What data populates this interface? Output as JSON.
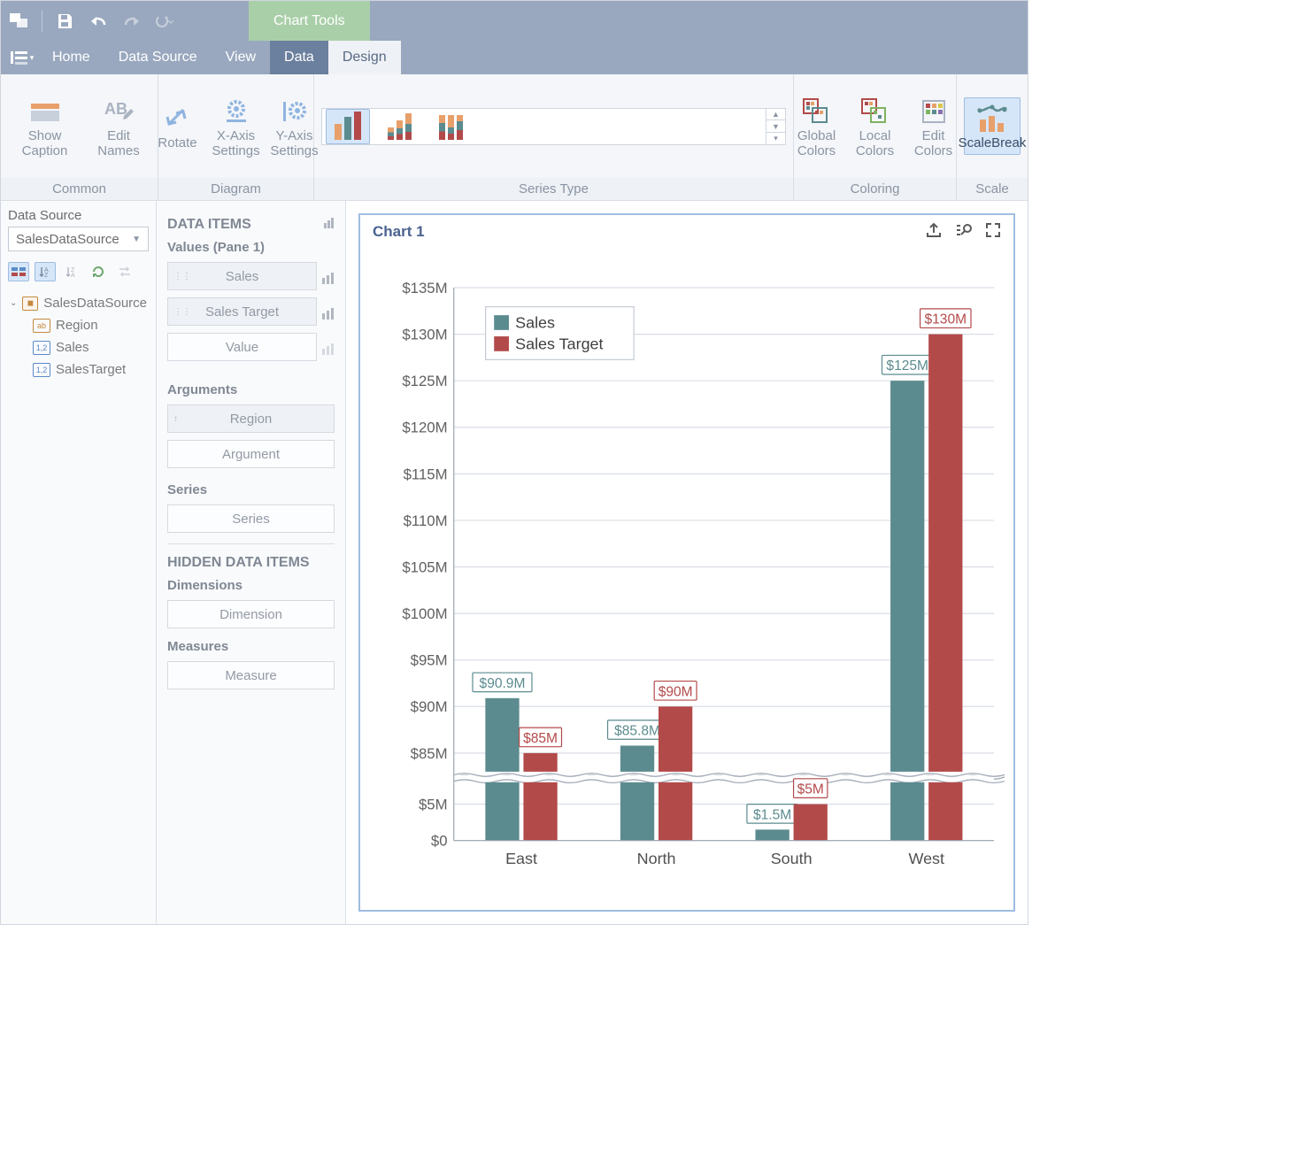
{
  "titlebar": {
    "chart_tools": "Chart Tools"
  },
  "menu": {
    "items": [
      "Home",
      "Data Source",
      "View",
      "Data",
      "Design"
    ]
  },
  "ribbon": {
    "groups": {
      "common": {
        "label": "Common",
        "show_caption": "Show Caption",
        "edit_names": "Edit Names"
      },
      "diagram": {
        "label": "Diagram",
        "rotate": "Rotate",
        "xaxis": "X-Axis\nSettings",
        "yaxis": "Y-Axis\nSettings"
      },
      "series_type": {
        "label": "Series Type"
      },
      "coloring": {
        "label": "Coloring",
        "global": "Global\nColors",
        "local": "Local\nColors",
        "edit": "Edit Colors"
      },
      "scale": {
        "label": "Scale",
        "scalebreak": "ScaleBreak"
      }
    }
  },
  "sidebar_left": {
    "label": "Data Source",
    "selected": "SalesDataSource",
    "tree_root": "SalesDataSource",
    "fields": [
      {
        "badge": "ab",
        "name": "Region",
        "color": "#c48a3f"
      },
      {
        "badge": "1,2",
        "name": "Sales",
        "color": "#5b8bc9"
      },
      {
        "badge": "1,2",
        "name": "SalesTarget",
        "color": "#5b8bc9"
      }
    ]
  },
  "sidebar_mid": {
    "data_items": "DATA ITEMS",
    "values_pane": "Values (Pane 1)",
    "value_slots": [
      "Sales",
      "Sales Target",
      "Value"
    ],
    "arguments_label": "Arguments",
    "argument_slots": [
      "Region",
      "Argument"
    ],
    "series_label": "Series",
    "series_slot": "Series",
    "hidden_label": "HIDDEN DATA ITEMS",
    "dimensions_label": "Dimensions",
    "dimension_slot": "Dimension",
    "measures_label": "Measures",
    "measure_slot": "Measure"
  },
  "chart": {
    "title": "Chart 1",
    "legend": [
      "Sales",
      "Sales Target"
    ]
  },
  "chart_data": {
    "type": "bar",
    "title": "Chart 1",
    "categories": [
      "East",
      "North",
      "South",
      "West"
    ],
    "series": [
      {
        "name": "Sales",
        "values": [
          90.9,
          85.8,
          1.5,
          125
        ],
        "color": "#5b8b8f",
        "labels": [
          "$90.9M",
          "$85.8M",
          "$1.5M",
          "$125M"
        ]
      },
      {
        "name": "Sales Target",
        "values": [
          85,
          90,
          5,
          130
        ],
        "color": "#b34a4a",
        "labels": [
          "$85M",
          "$90M",
          "$5M",
          "$130M"
        ]
      }
    ],
    "ylabel": "",
    "xlabel": "",
    "y_ticks_upper": [
      "$135M",
      "$130M",
      "$125M",
      "$120M",
      "$115M",
      "$110M",
      "$105M",
      "$100M",
      "$95M",
      "$90M",
      "$85M"
    ],
    "y_ticks_lower": [
      "$5M",
      "$0"
    ],
    "scale_break": true,
    "ylim": [
      0,
      135
    ]
  }
}
